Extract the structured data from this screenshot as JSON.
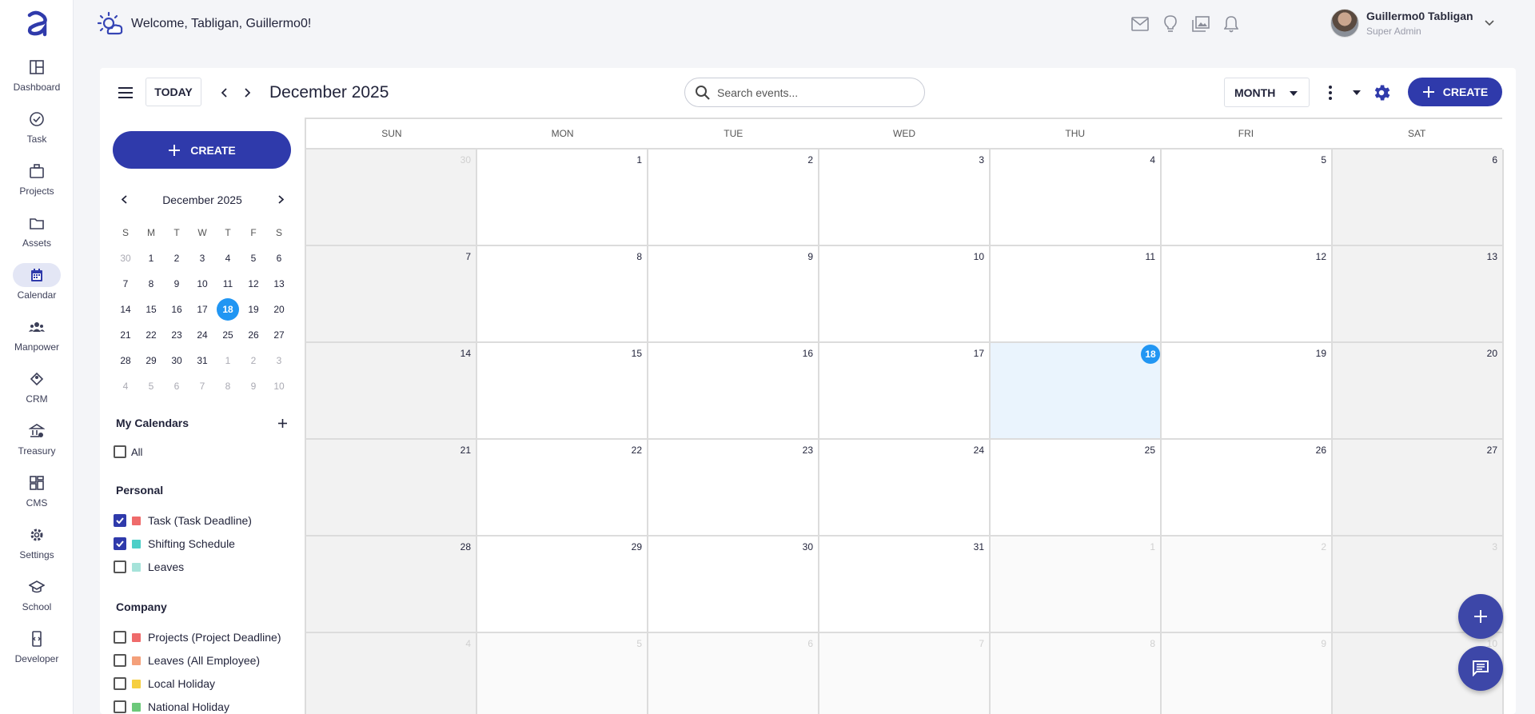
{
  "nav": {
    "logo": "logo-icon",
    "items": [
      {
        "label": "Dashboard",
        "icon": "dashboard-icon"
      },
      {
        "label": "Task",
        "icon": "task-icon"
      },
      {
        "label": "Projects",
        "icon": "projects-icon"
      },
      {
        "label": "Assets",
        "icon": "assets-icon"
      },
      {
        "label": "Calendar",
        "icon": "calendar-icon",
        "active": true
      },
      {
        "label": "Manpower",
        "icon": "manpower-icon"
      },
      {
        "label": "CRM",
        "icon": "crm-icon"
      },
      {
        "label": "Treasury",
        "icon": "treasury-icon"
      },
      {
        "label": "CMS",
        "icon": "cms-icon"
      },
      {
        "label": "Settings",
        "icon": "settings-icon"
      },
      {
        "label": "School",
        "icon": "school-icon"
      },
      {
        "label": "Developer",
        "icon": "developer-icon"
      }
    ]
  },
  "header": {
    "welcome": "Welcome, Tabligan, Guillermo0!",
    "icons": [
      "mail-icon",
      "lightbulb-icon",
      "gallery-icon",
      "bell-icon"
    ],
    "user": {
      "name": "Guillermo0 Tabligan",
      "role": "Super Admin"
    }
  },
  "toolbar": {
    "today_label": "TODAY",
    "title": "December 2025",
    "search_placeholder": "Search events...",
    "view_label": "MONTH",
    "create_label": "CREATE"
  },
  "side": {
    "create_label": "CREATE",
    "mini_title": "December 2025",
    "dow": [
      "S",
      "M",
      "T",
      "W",
      "T",
      "F",
      "S"
    ],
    "weeks": [
      [
        {
          "d": "30",
          "out": true
        },
        {
          "d": "1"
        },
        {
          "d": "2"
        },
        {
          "d": "3"
        },
        {
          "d": "4"
        },
        {
          "d": "5"
        },
        {
          "d": "6"
        }
      ],
      [
        {
          "d": "7"
        },
        {
          "d": "8"
        },
        {
          "d": "9"
        },
        {
          "d": "10"
        },
        {
          "d": "11"
        },
        {
          "d": "12"
        },
        {
          "d": "13"
        }
      ],
      [
        {
          "d": "14"
        },
        {
          "d": "15"
        },
        {
          "d": "16"
        },
        {
          "d": "17"
        },
        {
          "d": "18",
          "today": true
        },
        {
          "d": "19"
        },
        {
          "d": "20"
        }
      ],
      [
        {
          "d": "21"
        },
        {
          "d": "22"
        },
        {
          "d": "23"
        },
        {
          "d": "24"
        },
        {
          "d": "25"
        },
        {
          "d": "26"
        },
        {
          "d": "27"
        }
      ],
      [
        {
          "d": "28"
        },
        {
          "d": "29"
        },
        {
          "d": "30"
        },
        {
          "d": "31"
        },
        {
          "d": "1",
          "out": true
        },
        {
          "d": "2",
          "out": true
        },
        {
          "d": "3",
          "out": true
        }
      ],
      [
        {
          "d": "4",
          "out": true
        },
        {
          "d": "5",
          "out": true
        },
        {
          "d": "6",
          "out": true
        },
        {
          "d": "7",
          "out": true
        },
        {
          "d": "8",
          "out": true
        },
        {
          "d": "9",
          "out": true
        },
        {
          "d": "10",
          "out": true
        }
      ]
    ],
    "my_calendars": {
      "title": "My Calendars",
      "all_label": "All"
    },
    "personal": {
      "title": "Personal",
      "items": [
        {
          "label": "Task (Task Deadline)",
          "color": "#ef6b6b",
          "checked": true
        },
        {
          "label": "Shifting Schedule",
          "color": "#4dcfc8",
          "checked": true
        },
        {
          "label": "Leaves",
          "color": "#a6e3da",
          "checked": false
        }
      ]
    },
    "company": {
      "title": "Company",
      "items": [
        {
          "label": "Projects (Project Deadline)",
          "color": "#ef6b6b",
          "checked": false
        },
        {
          "label": "Leaves (All Employee)",
          "color": "#f4a07a",
          "checked": false
        },
        {
          "label": "Local Holiday",
          "color": "#f6cf3f",
          "checked": false
        },
        {
          "label": "National Holiday",
          "color": "#6cc97a",
          "checked": false
        }
      ]
    }
  },
  "month": {
    "dow": [
      "SUN",
      "MON",
      "TUE",
      "WED",
      "THU",
      "FRI",
      "SAT"
    ],
    "weeks": [
      [
        {
          "d": "30",
          "out": true
        },
        {
          "d": "1"
        },
        {
          "d": "2"
        },
        {
          "d": "3"
        },
        {
          "d": "4"
        },
        {
          "d": "5"
        },
        {
          "d": "6"
        }
      ],
      [
        {
          "d": "7"
        },
        {
          "d": "8"
        },
        {
          "d": "9"
        },
        {
          "d": "10"
        },
        {
          "d": "11"
        },
        {
          "d": "12"
        },
        {
          "d": "13"
        }
      ],
      [
        {
          "d": "14"
        },
        {
          "d": "15"
        },
        {
          "d": "16"
        },
        {
          "d": "17"
        },
        {
          "d": "18",
          "today": true
        },
        {
          "d": "19"
        },
        {
          "d": "20"
        }
      ],
      [
        {
          "d": "21"
        },
        {
          "d": "22"
        },
        {
          "d": "23"
        },
        {
          "d": "24"
        },
        {
          "d": "25"
        },
        {
          "d": "26"
        },
        {
          "d": "27"
        }
      ],
      [
        {
          "d": "28"
        },
        {
          "d": "29"
        },
        {
          "d": "30"
        },
        {
          "d": "31"
        },
        {
          "d": "1",
          "out": true
        },
        {
          "d": "2",
          "out": true
        },
        {
          "d": "3",
          "out": true
        }
      ],
      [
        {
          "d": "4",
          "out": true
        },
        {
          "d": "5",
          "out": true
        },
        {
          "d": "6",
          "out": true
        },
        {
          "d": "7",
          "out": true
        },
        {
          "d": "8",
          "out": true
        },
        {
          "d": "9",
          "out": true
        },
        {
          "d": "10",
          "out": true
        }
      ]
    ]
  },
  "fabs": [
    "plus-icon",
    "chat-icon"
  ],
  "colors": {
    "primary": "#2f3aab",
    "today": "#2196f3",
    "today_bg": "#eaf4fd"
  }
}
